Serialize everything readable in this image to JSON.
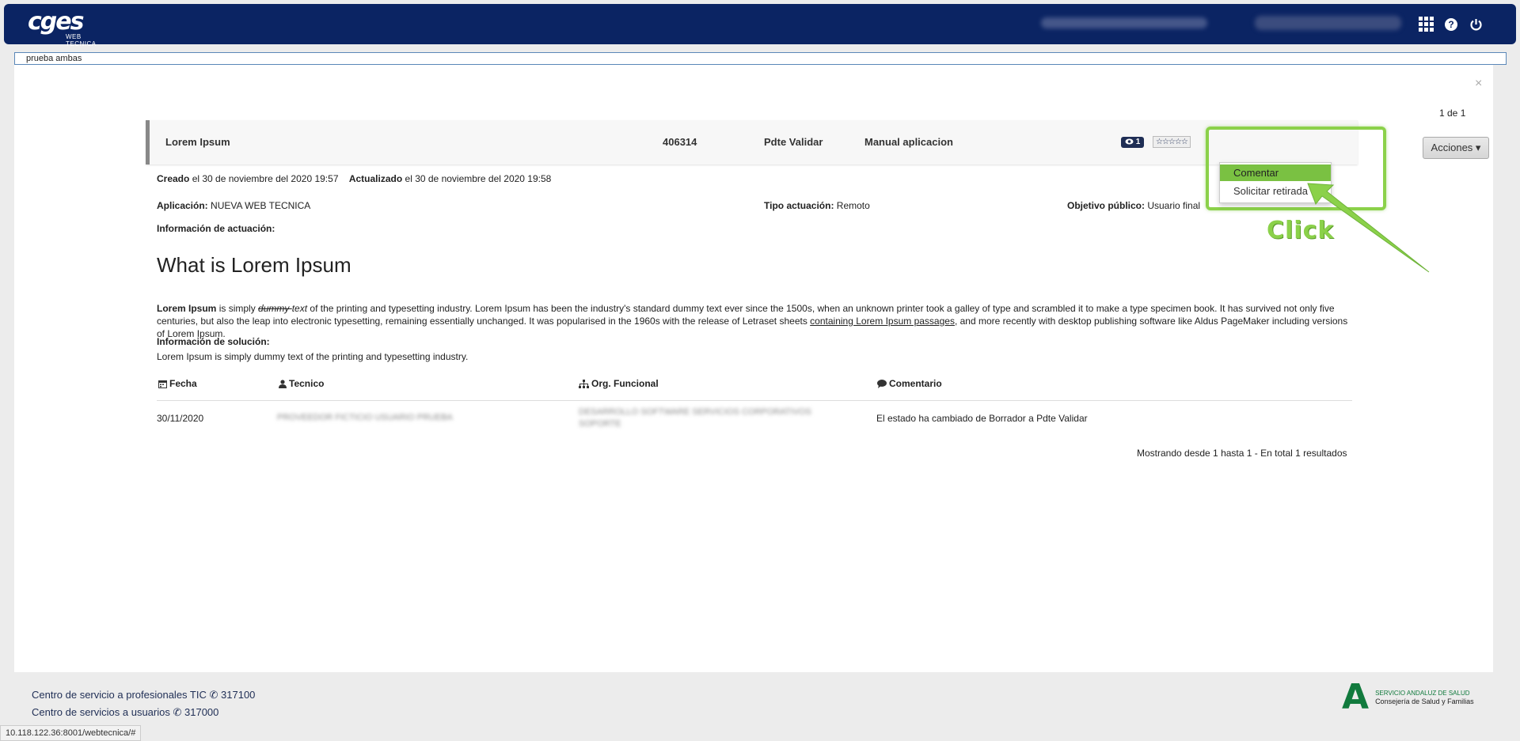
{
  "header": {
    "logo_main": "cges",
    "logo_sub": "WEB TECNICA"
  },
  "search": {
    "value": "prueba ambas"
  },
  "panel": {
    "close": "×",
    "pager": "1 de 1"
  },
  "card": {
    "title": "Lorem Ipsum",
    "id": "406314",
    "status": "Pdte Validar",
    "type": "Manual aplicacion",
    "views": "1",
    "stars": "☆☆☆☆☆",
    "actions_label": "Acciones ▾"
  },
  "dropdown": {
    "items": [
      "Comentar",
      "Solicitar retirada"
    ]
  },
  "annotation": {
    "click": "Click"
  },
  "meta": {
    "created_label": "Creado",
    "created_value": "el 30 de noviembre del 2020 19:57",
    "updated_label": "Actualizado",
    "updated_value": "el 30 de noviembre del 2020 19:58",
    "app_label": "Aplicación:",
    "app_value": "NUEVA WEB TECNICA",
    "tipo_label": "Tipo actuación:",
    "tipo_value": "Remoto",
    "objetivo_label": "Objetivo público:",
    "objetivo_value": "Usuario final",
    "info_label": "Información de actuación:",
    "solucion_label": "Información de solución:",
    "solucion_value": "Lorem Ipsum is simply dummy text of the printing and typesetting industry."
  },
  "article": {
    "heading": "What is Lorem Ipsum",
    "p_bold": "Lorem Ipsum",
    "p_1": " is simply ",
    "p_strike": "dummy ",
    "p_ital": "text",
    "p_2": " of the printing and typesetting industry. Lorem Ipsum has been the industry's standard dummy text ever since the 1500s, when an unknown printer took a galley of type and scrambled it to make a type specimen book. It has survived not only five centuries, but also the leap into electronic typesetting, remaining essentially unchanged. It was popularised in the 1960s with the release of Letraset sheets ",
    "p_link": "containing Lorem Ipsum passages",
    "p_3": ", and more recently with desktop publishing software like Aldus PageMaker including versions of Lorem Ipsum."
  },
  "table": {
    "headers": [
      "Fecha",
      "Tecnico",
      "Org. Funcional",
      "Comentario"
    ],
    "rows": [
      {
        "fecha": "30/11/2020",
        "tecnico": "PROVEEDOR FICTICIO USUARIO PRUEBA",
        "org": "DESARROLLO SOFTWARE SERVICIOS CORPORATIVOS SOPORTE",
        "comentario": "El estado ha cambiado de Borrador a Pdte Validar"
      }
    ],
    "summary": "Mostrando desde 1 hasta 1 - En total 1 resultados"
  },
  "footer": {
    "line1_text": "Centro de servicio a profesionales TIC",
    "line1_phone": "317100",
    "line2_text": "Centro de servicios a usuarios",
    "line2_phone": "317000",
    "url": "10.118.122.36:8001/webtecnica/#",
    "org_logo_letter": "A",
    "org_line1": "SERVICIO ANDALUZ DE SALUD",
    "org_line2": "Consejería de Salud y Familias"
  }
}
